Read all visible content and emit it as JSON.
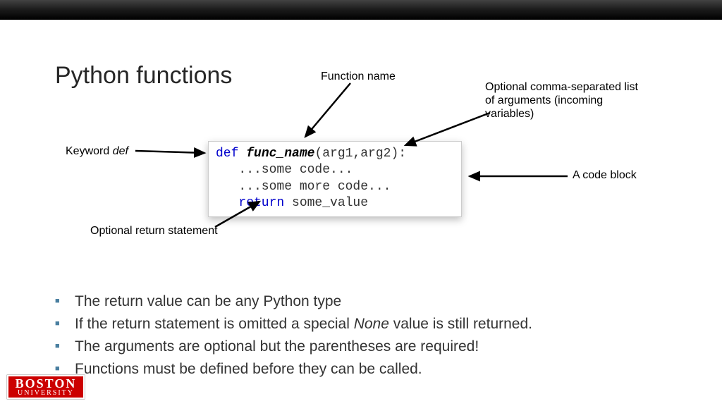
{
  "title": "Python functions",
  "annotations": {
    "function_name": "Function name",
    "arguments": "Optional comma-separated list of arguments (incoming variables)",
    "keyword_def_pre": "Keyword ",
    "keyword_def_it": "def",
    "code_block": "A code block",
    "return_stmt": "Optional return statement"
  },
  "code": {
    "def": "def",
    "space1": " ",
    "fname": "func_name",
    "args": "(arg1,arg2):",
    "l2": "   ...some code...",
    "l3": "   ...some more code...",
    "ret": "   return",
    "retval": " some_value"
  },
  "bullets": [
    "The return value can be any Python type",
    {
      "pre": "If the return statement is omitted a special ",
      "it": "None",
      "post": " value is still returned."
    },
    "The arguments are optional but the parentheses are required!",
    "Functions must be defined before they can be called."
  ],
  "logo": {
    "l1": "BOSTON",
    "l2": "UNIVERSITY"
  }
}
